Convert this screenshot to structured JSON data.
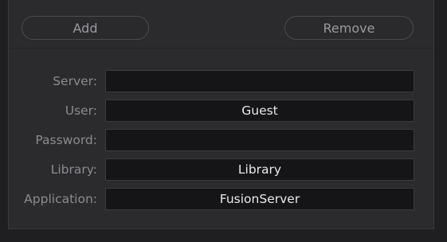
{
  "buttons": {
    "add_label": "Add",
    "remove_label": "Remove"
  },
  "form": {
    "server": {
      "label": "Server:",
      "value": ""
    },
    "user": {
      "label": "User:",
      "value": "Guest"
    },
    "password": {
      "label": "Password:",
      "value": ""
    },
    "library": {
      "label": "Library:",
      "value": "Library"
    },
    "application": {
      "label": "Application:",
      "value": "FusionServer"
    }
  }
}
